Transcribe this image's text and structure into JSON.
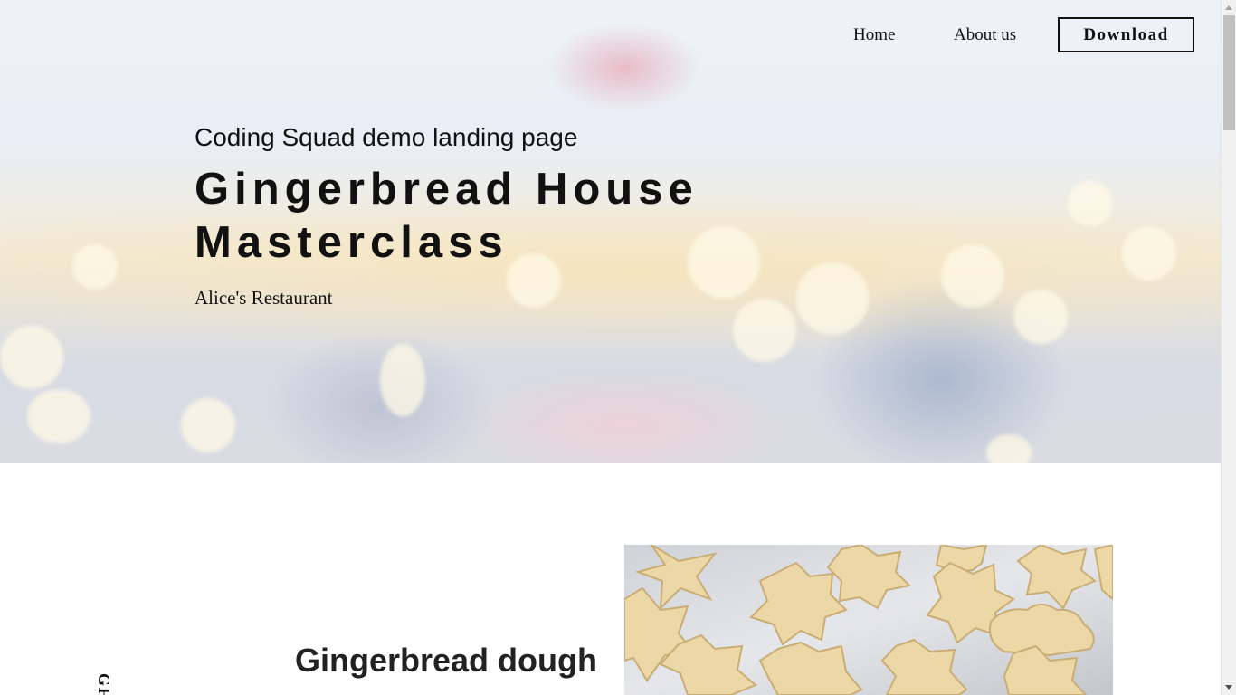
{
  "nav": {
    "home_label": "Home",
    "about_label": "About us",
    "download_label": "Download"
  },
  "hero": {
    "kicker": "Coding Squad demo landing page",
    "title": "Gingerbread House Masterclass",
    "subtitle": "Alice's Restaurant"
  },
  "section": {
    "heading": "Gingerbread dough",
    "vertical_label": "GH",
    "image_name": "gingerbread-cookies-image"
  },
  "colors": {
    "text": "#111111",
    "cookie_dough": "#ecd7a6",
    "background": "#ffffff"
  }
}
